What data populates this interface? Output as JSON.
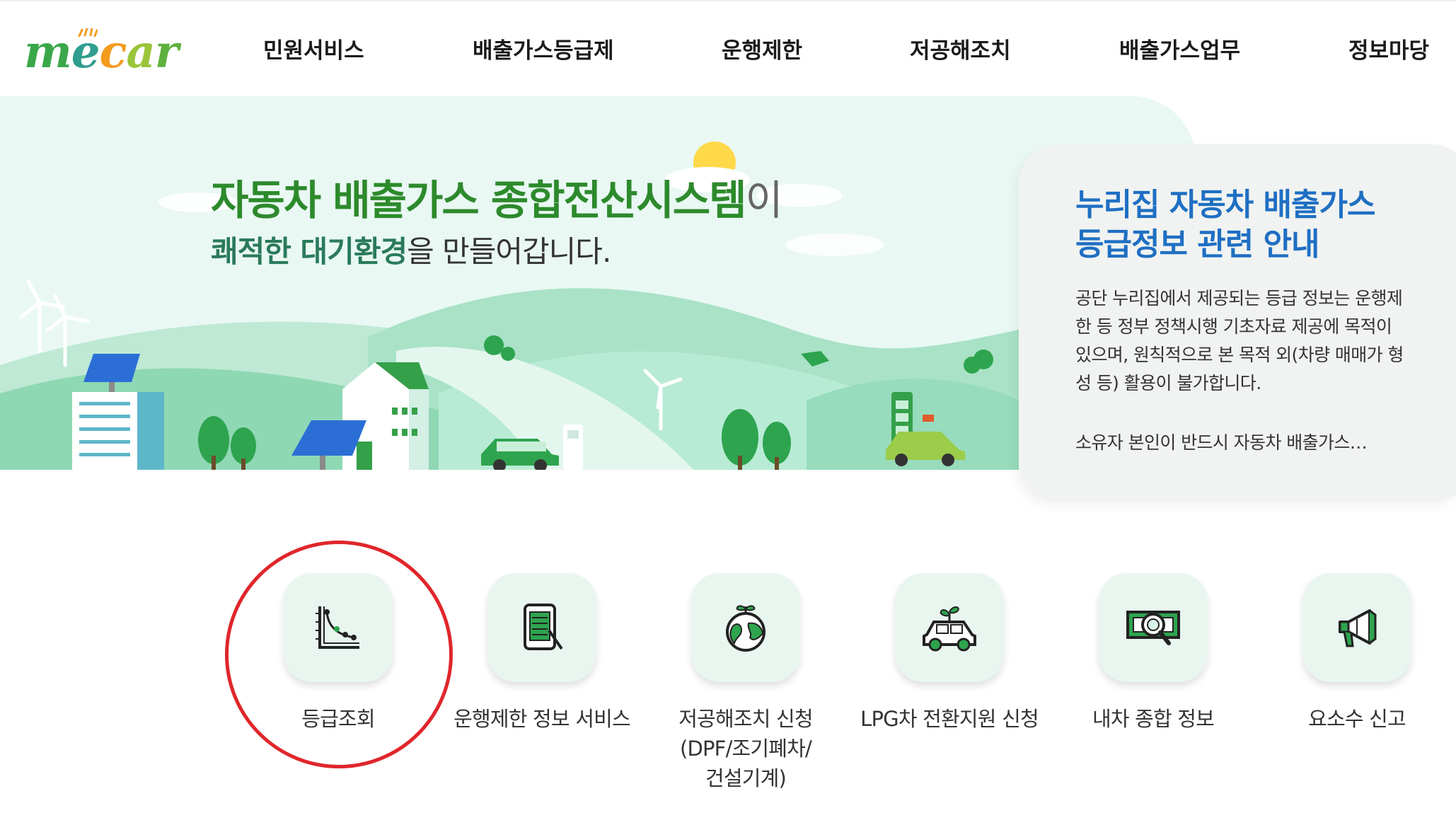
{
  "header": {
    "logo": "mecar",
    "nav": [
      "민원서비스",
      "배출가스등급제",
      "운행제한",
      "저공해조치",
      "배출가스업무",
      "정보마당"
    ]
  },
  "hero": {
    "title_em": "자동차 배출가스 종합전산시스템",
    "title_rest": "이",
    "subtitle_em": "쾌적한 대기환경",
    "subtitle_rest": "을 만들어갑니다."
  },
  "notice": {
    "title_line1": "누리집 자동차 배출가스",
    "title_line2": "등급정보 관련 안내",
    "body": "공단 누리집에서 제공되는 등급 정보는 운행제한 등 정부 정책시행 기초자료 제공에 목적이 있으며, 원칙적으로 본 목적 외(차량 매매가 형성 등) 활용이 불가합니다.",
    "more": "소유자 본인이 반드시 자동차 배출가스…"
  },
  "quick_menu": [
    {
      "label": "등급조회",
      "icon": "chart-curve-icon"
    },
    {
      "label": "운행제한 정보 서비스",
      "icon": "tablet-pen-icon"
    },
    {
      "label": "저공해조치 신청\n(DPF/조기폐차/\n건설기계)",
      "icon": "earth-sprout-icon"
    },
    {
      "label": "LPG차 전환지원 신청",
      "icon": "eco-car-icon"
    },
    {
      "label": "내차 종합 정보",
      "icon": "money-search-icon"
    },
    {
      "label": "요소수 신고",
      "icon": "megaphone-icon"
    }
  ],
  "colors": {
    "brand_green": "#2d8a2c",
    "notice_blue": "#1f6fc3",
    "highlight_red": "#e0262b",
    "icon_bg": "#e8f6ef"
  }
}
